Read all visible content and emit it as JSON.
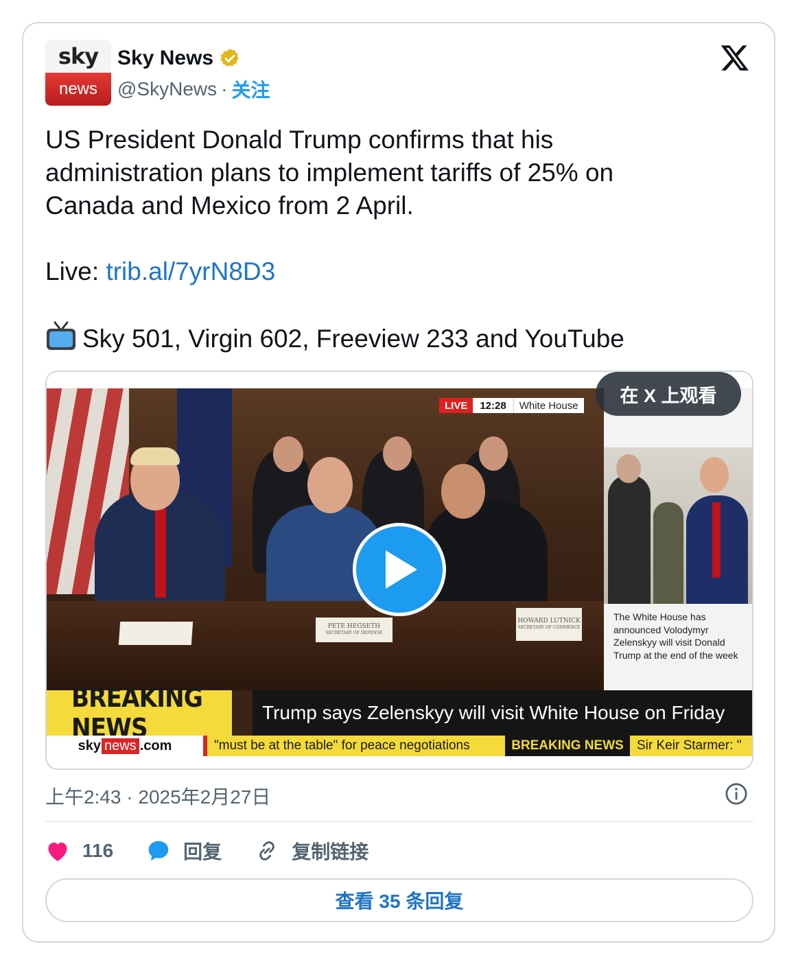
{
  "account": {
    "avatar_top": "sky",
    "avatar_bottom": "news",
    "name": "Sky News",
    "handle": "@SkyNews",
    "separator": "·",
    "follow_label": "关注"
  },
  "tweet": {
    "line1": "US President Donald Trump confirms that his",
    "line2": "administration plans to implement tariffs of 25% on",
    "line3": "Canada and Mexico from 2 April.",
    "live_prefix": "Live: ",
    "live_link": "trib.al/7yrN8D3",
    "channels": "Sky 501, Virgin 602, Freeview 233 and YouTube",
    "channels_icon": "tv-icon"
  },
  "video": {
    "live_tag": "LIVE",
    "live_time": "12:28",
    "live_location": "White House",
    "watch_on_x": "在 X 上观看",
    "nameplate_left": "PETE HEGSETH",
    "nameplate_left_sub": "SECRETARY OF DEFENSE",
    "nameplate_right": "HOWARD LUTNICK",
    "nameplate_right_sub": "SECRETARY OF COMMERCE",
    "side_caption": "The White House has announced Volodymyr Zelenskyy will visit Donald Trump at the end of the week",
    "breaking_label": "BREAKING NEWS",
    "breaking_headline": "Trump says Zelenskyy will visit White House on Friday",
    "ticker_brand_sky": "sky",
    "ticker_brand_news": "news",
    "ticker_brand_com": ".com",
    "ticker_message": "\"must be at the table\" for peace negotiations",
    "ticker_breaking": "BREAKING NEWS",
    "ticker_next": "Sir Keir Starmer: \""
  },
  "footer": {
    "timestamp": "上午2:43 · 2025年2月27日",
    "likes": "116",
    "reply_label": "回复",
    "copy_link_label": "复制链接",
    "view_replies": "查看 35 条回复"
  },
  "colors": {
    "link": "#1d74c8",
    "follow": "#1d9bf0",
    "like": "#f91880",
    "reply_bubble": "#1d9bf0",
    "verified_gold": "#e2b719"
  }
}
